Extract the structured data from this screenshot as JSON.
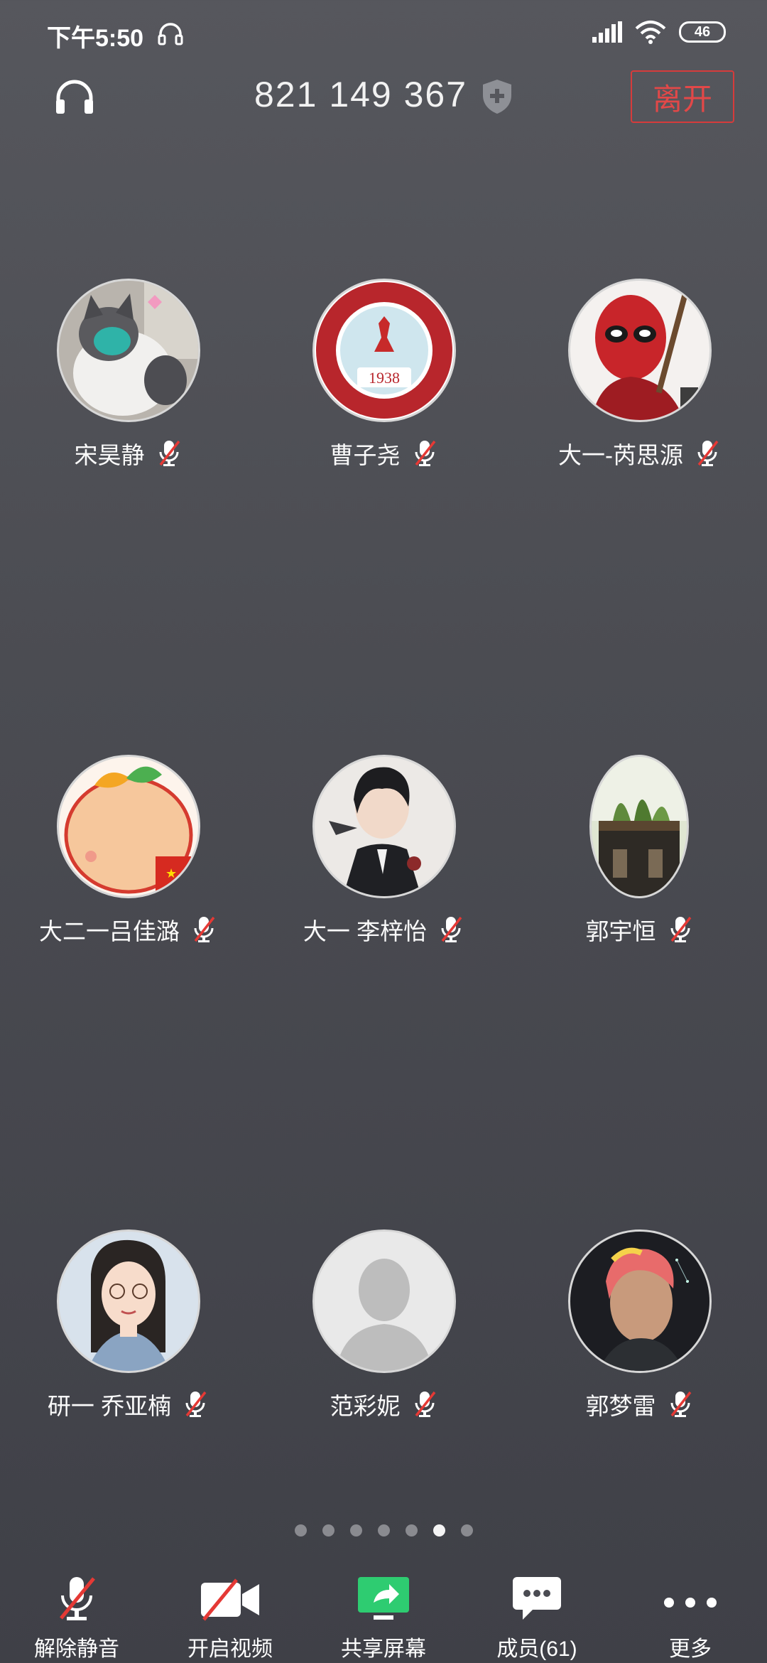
{
  "status": {
    "time": "下午5:50",
    "battery": "46"
  },
  "header": {
    "meeting_id": "821 149 367",
    "leave_label": "离开"
  },
  "participants": [
    {
      "name": "宋昊静"
    },
    {
      "name": "曹子尧"
    },
    {
      "name": "大一-芮思源"
    },
    {
      "name": "大二一吕佳潞"
    },
    {
      "name": "大一 李梓怡"
    },
    {
      "name": "郭宇恒"
    },
    {
      "name": "研一 乔亚楠"
    },
    {
      "name": "范彩妮"
    },
    {
      "name": "郭梦雷"
    }
  ],
  "avatar_texts": {
    "nwpu_year": "1938"
  },
  "pager": {
    "count": 7,
    "active_index": 5
  },
  "toolbar": {
    "unmute_label": "解除静音",
    "video_label": "开启视频",
    "share_label": "共享屏幕",
    "members_label": "成员(61)",
    "more_label": "更多"
  },
  "colors": {
    "leave_red": "#e24848",
    "share_green": "#2ecc71",
    "mute_red": "#e53935"
  }
}
